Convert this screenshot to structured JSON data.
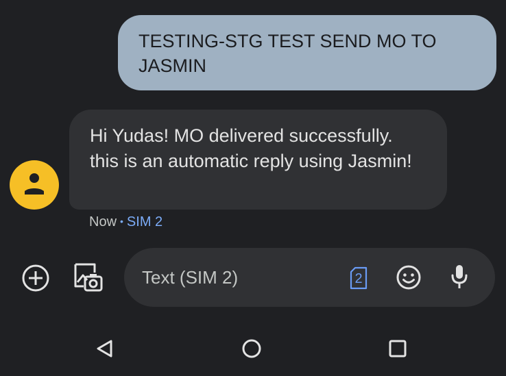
{
  "conversation": {
    "outgoing_message": "TESTING-STG TEST SEND MO TO JASMIN",
    "incoming_message": "Hi Yudas! MO delivered successfully. this is an automatic reply using Jasmin!",
    "incoming_meta": {
      "time": "Now",
      "separator": "•",
      "sim": "SIM 2"
    }
  },
  "compose": {
    "placeholder": "Text (SIM 2)",
    "value": "",
    "sim_badge": "2"
  },
  "icons": {
    "attach": "add-circle-icon",
    "gallery": "gallery-camera-icon",
    "sim": "sim-card-icon",
    "emoji": "emoji-icon",
    "voice": "microphone-icon",
    "avatar": "person-icon",
    "nav_back": "back-triangle-icon",
    "nav_home": "home-circle-icon",
    "nav_recents": "recents-square-icon"
  },
  "colors": {
    "background": "#1f2023",
    "outgoing_bubble": "#9fb1c2",
    "incoming_bubble": "#303134",
    "avatar": "#f6bf26",
    "accent": "#7cacf8"
  }
}
